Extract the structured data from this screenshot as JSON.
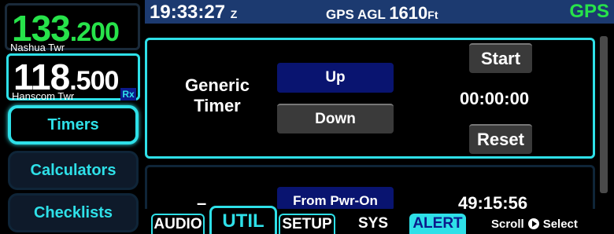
{
  "com": {
    "active": {
      "freq_main": "133",
      "freq_dec": ".200",
      "name": "Nashua Twr"
    },
    "standby": {
      "freq_main": "118",
      "freq_dec": ".500",
      "name": "Hanscom Twr",
      "rx": "Rx"
    }
  },
  "sidebar": {
    "items": [
      {
        "label": "Timers"
      },
      {
        "label": "Calculators"
      },
      {
        "label": "Checklists"
      }
    ]
  },
  "topbar": {
    "time": "19:33:27",
    "zone": "Z",
    "agl_label": "GPS AGL",
    "agl_value": "1610",
    "agl_unit": "Ft",
    "nav_source": "GPS"
  },
  "generic_timer": {
    "label_line1": "Generic",
    "label_line2": "Timer",
    "up_label": "Up",
    "down_label": "Down",
    "start_label": "Start",
    "reset_label": "Reset",
    "time": "00:00:00"
  },
  "power_timer": {
    "dash": "–",
    "mode_label": "From Pwr-On",
    "time": "49:15:56"
  },
  "tabs": {
    "audio": "AUDIO",
    "util": "UTIL",
    "setup": "SETUP",
    "sys": "SYS",
    "alert": "ALERT"
  },
  "hint": {
    "scroll": "Scroll",
    "select": "Select",
    "icon": "knob-push-icon"
  },
  "colors": {
    "accent": "#2ee0e8",
    "active_freq": "#27e34a",
    "topbar_bg": "#1c3a70",
    "button_blue": "#091470"
  }
}
